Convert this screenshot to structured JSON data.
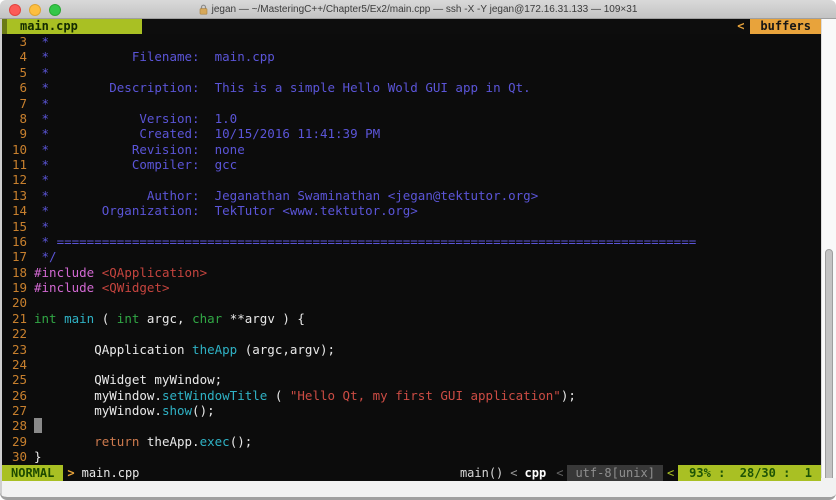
{
  "window": {
    "title": "jegan — ~/MasteringC++/Chapter5/Ex2/main.cpp — ssh -X -Y jegan@172.16.31.133 — 109×31"
  },
  "tabline": {
    "tab": "main.cpp",
    "chevron": "<",
    "buffers_label": "buffers"
  },
  "statusline": {
    "mode": "NORMAL",
    "left_sep": ">",
    "filename": "main.cpp",
    "context": "main()",
    "sep_a": "<",
    "filetype": "cpp",
    "sep_b": "<",
    "encoding": "utf-8[unix]",
    "sep_c": "<",
    "scroll_position": "93% :  28/30 :  1"
  },
  "colors": {
    "terminal_bg": "#0c0c0c",
    "tab_green": "#a9c023",
    "accent_orange": "#e8a33b",
    "line_number_orange": "#c8802e",
    "comment_blue": "#5b55d8",
    "include_magenta": "#d168d1",
    "header_string_red": "#c5443e",
    "keyword_green": "#31a745",
    "function_cyan": "#2fb2c5",
    "return_orange": "#cd7a4e",
    "status_green_text": "#1d5406",
    "encoding_bg_gray": "#383838",
    "cursor_gray": "#8a8a8a",
    "traffic_red": "#fc5b57",
    "traffic_yellow": "#fdbe3f",
    "traffic_green": "#34c748"
  },
  "code": {
    "first_line": 3,
    "last_line": 30,
    "lines": [
      {
        "n": 3,
        "segs": [
          [
            "cm",
            " *"
          ]
        ]
      },
      {
        "n": 4,
        "segs": [
          [
            "cm",
            " *           Filename:  main.cpp"
          ]
        ]
      },
      {
        "n": 5,
        "segs": [
          [
            "cm",
            " *"
          ]
        ]
      },
      {
        "n": 6,
        "segs": [
          [
            "cm",
            " *        Description:  This is a simple Hello Wold GUI app in Qt."
          ]
        ]
      },
      {
        "n": 7,
        "segs": [
          [
            "cm",
            " *"
          ]
        ]
      },
      {
        "n": 8,
        "segs": [
          [
            "cm",
            " *            Version:  1.0"
          ]
        ]
      },
      {
        "n": 9,
        "segs": [
          [
            "cm",
            " *            Created:  10/15/2016 11:41:39 PM"
          ]
        ]
      },
      {
        "n": 10,
        "segs": [
          [
            "cm",
            " *           Revision:  none"
          ]
        ]
      },
      {
        "n": 11,
        "segs": [
          [
            "cm",
            " *           Compiler:  gcc"
          ]
        ]
      },
      {
        "n": 12,
        "segs": [
          [
            "cm",
            " *"
          ]
        ]
      },
      {
        "n": 13,
        "segs": [
          [
            "cm",
            " *             Author:  Jeganathan Swaminathan <jegan@tektutor.org>"
          ]
        ]
      },
      {
        "n": 14,
        "segs": [
          [
            "cm",
            " *       Organization:  TekTutor <www.tektutor.org>"
          ]
        ]
      },
      {
        "n": 15,
        "segs": [
          [
            "cm",
            " *"
          ]
        ]
      },
      {
        "n": 16,
        "segs": [
          [
            "cm",
            " * ====================================================================================="
          ]
        ]
      },
      {
        "n": 17,
        "segs": [
          [
            "cm",
            " */"
          ]
        ]
      },
      {
        "n": 18,
        "segs": [
          [
            "inc",
            "#include"
          ],
          [
            "w",
            " "
          ],
          [
            "hdr",
            "<QApplication>"
          ]
        ]
      },
      {
        "n": 19,
        "segs": [
          [
            "inc",
            "#include"
          ],
          [
            "w",
            " "
          ],
          [
            "hdr",
            "<QWidget>"
          ]
        ]
      },
      {
        "n": 20,
        "segs": []
      },
      {
        "n": 21,
        "segs": [
          [
            "kw",
            "int"
          ],
          [
            "w",
            " "
          ],
          [
            "fn",
            "main"
          ],
          [
            "w",
            " ( "
          ],
          [
            "kw",
            "int"
          ],
          [
            "w",
            " argc, "
          ],
          [
            "kw",
            "char"
          ],
          [
            "w",
            " **argv ) {"
          ]
        ]
      },
      {
        "n": 22,
        "segs": []
      },
      {
        "n": 23,
        "segs": [
          [
            "w",
            "        QApplication "
          ],
          [
            "fn",
            "theApp"
          ],
          [
            "w",
            " (argc,argv);"
          ]
        ]
      },
      {
        "n": 24,
        "segs": []
      },
      {
        "n": 25,
        "segs": [
          [
            "w",
            "        QWidget myWindow;"
          ]
        ]
      },
      {
        "n": 26,
        "segs": [
          [
            "w",
            "        myWindow."
          ],
          [
            "fn",
            "setWindowTitle"
          ],
          [
            "w",
            " ( "
          ],
          [
            "str",
            "\"Hello Qt, my first GUI application\""
          ],
          [
            "w",
            ");"
          ]
        ]
      },
      {
        "n": 27,
        "segs": [
          [
            "w",
            "        myWindow."
          ],
          [
            "fn",
            "show"
          ],
          [
            "w",
            "();"
          ]
        ]
      },
      {
        "n": 28,
        "segs": [
          [
            "cur",
            " "
          ]
        ]
      },
      {
        "n": 29,
        "segs": [
          [
            "w",
            "        "
          ],
          [
            "ret",
            "return"
          ],
          [
            "w",
            " theApp."
          ],
          [
            "fn",
            "exec"
          ],
          [
            "w",
            "();"
          ]
        ]
      },
      {
        "n": 30,
        "segs": [
          [
            "w",
            "}"
          ]
        ]
      }
    ]
  }
}
